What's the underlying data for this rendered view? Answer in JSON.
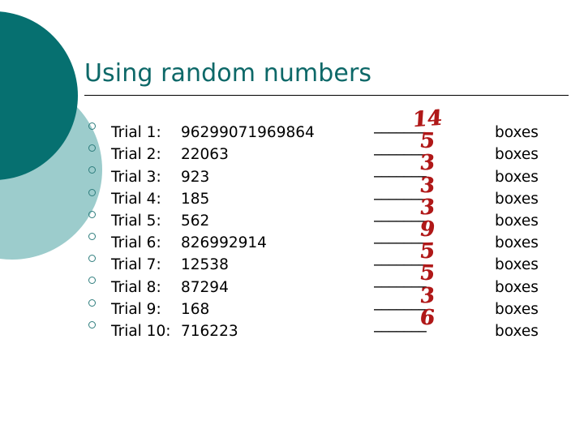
{
  "slide": {
    "title": "Using random numbers",
    "theme": {
      "title_color": "#0d6868",
      "dark_circle_color": "#067070",
      "light_circle_color": "#9ccccc",
      "bullet_color": "#2e7d7d",
      "handwriting_color": "#b01818",
      "rule_color": "#000000",
      "background": "#ffffff"
    },
    "blank_line": "_______",
    "unit_label": "boxes",
    "bullet_icon": "hollow-circle-bullet",
    "rows": [
      {
        "label": "Trial 1:",
        "value": "96299071969864",
        "answer": "14"
      },
      {
        "label": "Trial 2:",
        "value": "22063",
        "answer": "5"
      },
      {
        "label": "Trial 3:",
        "value": "923",
        "answer": "3"
      },
      {
        "label": "Trial 4:",
        "value": "185",
        "answer": "3"
      },
      {
        "label": "Trial 5:",
        "value": "562",
        "answer": "3"
      },
      {
        "label": "Trial 6:",
        "value": "826992914",
        "answer": "9"
      },
      {
        "label": "Trial 7:",
        "value": "12538",
        "answer": "5"
      },
      {
        "label": "Trial 8:",
        "value": "87294",
        "answer": "5"
      },
      {
        "label": "Trial 9:",
        "value": "168",
        "answer": "3"
      },
      {
        "label": "Trial 10:",
        "value": "716223",
        "answer": "6"
      }
    ],
    "units": [
      "boxes",
      "boxes",
      "boxes",
      "boxes",
      "boxes",
      "boxes",
      "boxes",
      "boxes",
      "boxes",
      "boxes"
    ]
  }
}
